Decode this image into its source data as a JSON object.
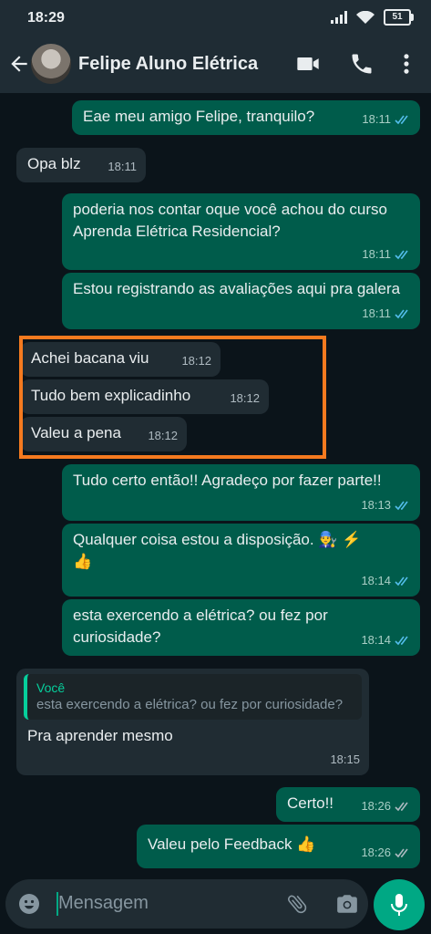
{
  "status_bar": {
    "time": "18:29",
    "battery": "51"
  },
  "header": {
    "contact_name": "Felipe Aluno Elétrica"
  },
  "messages": [
    {
      "text": "Eae meu amigo Felipe, tranquilo?",
      "time": "18:11"
    },
    {
      "text": "Opa blz",
      "time": "18:11"
    },
    {
      "text": "poderia nos contar oque você achou do curso Aprenda Elétrica Residencial?",
      "time": "18:11"
    },
    {
      "text": "Estou registrando as avaliações aqui pra galera",
      "time": "18:11"
    },
    {
      "text": "Achei bacana viu",
      "time": "18:12"
    },
    {
      "text": "Tudo bem explicadinho",
      "time": "18:12"
    },
    {
      "text": "Valeu a pena",
      "time": "18:12"
    },
    {
      "text": "Tudo certo então!! Agradeço por fazer parte!!",
      "time": "18:13"
    },
    {
      "text": "Qualquer coisa estou a disposição. 👨‍🔧 ⚡👍",
      "time": "18:14"
    },
    {
      "text": "esta exercendo a elétrica? ou fez por curiosidade?",
      "time": "18:14"
    },
    {
      "text": "Pra aprender mesmo",
      "time": "18:15",
      "reply_author": "Você",
      "reply_text": "esta exercendo a elétrica? ou fez por curiosidade?"
    },
    {
      "text": "Certo!!",
      "time": "18:26"
    },
    {
      "text": "Valeu pelo Feedback 👍",
      "time": "18:26"
    }
  ],
  "input": {
    "placeholder": "Mensagem"
  },
  "colors": {
    "outgoing": "#005c4b",
    "incoming": "#202c33",
    "accent": "#00a884",
    "highlight": "#f57a1f",
    "ticks_read": "#53bdeb"
  },
  "icons": [
    "back-arrow-icon",
    "video-call-icon",
    "phone-icon",
    "more-vertical-icon",
    "emoji-icon",
    "attach-icon",
    "camera-icon",
    "mic-icon",
    "read-ticks-icon",
    "delivered-ticks-icon"
  ]
}
